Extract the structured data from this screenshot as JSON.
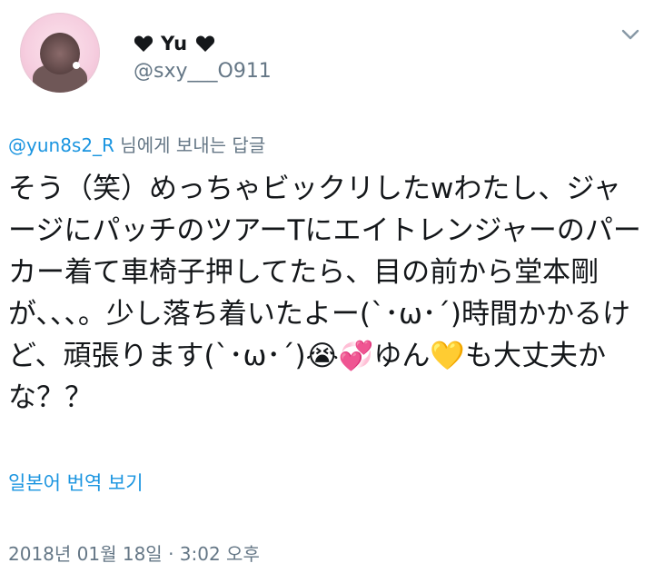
{
  "user": {
    "display_name": "Yu",
    "heart_left": "❤",
    "heart_right": "❤",
    "username": "@sxy___O911"
  },
  "reply": {
    "mention": "@yun8s2_R",
    "suffix": " 님에게 보내는 답글"
  },
  "tweet": {
    "text": "そう（笑）めっちゃビックリしたwわたし、ジャージにパッチのツアーTにエイトレンジャーのパーカー着て車椅子押してたら、目の前から堂本剛が、、、。少し落ち着いたよー(`･ω･´)時間かかるけど、頑張ります(`･ω･´)😭💞ゆん💛も大丈夫かな？？"
  },
  "translate_label": "일본어 번역 보기",
  "timestamp": "2018년 01월 18일 · 3:02 오후",
  "icons": {
    "menu": "chevron-down-icon",
    "heart": "heart-icon"
  },
  "colors": {
    "link": "#1b95e0",
    "secondary": "#657786",
    "text": "#14171a"
  }
}
